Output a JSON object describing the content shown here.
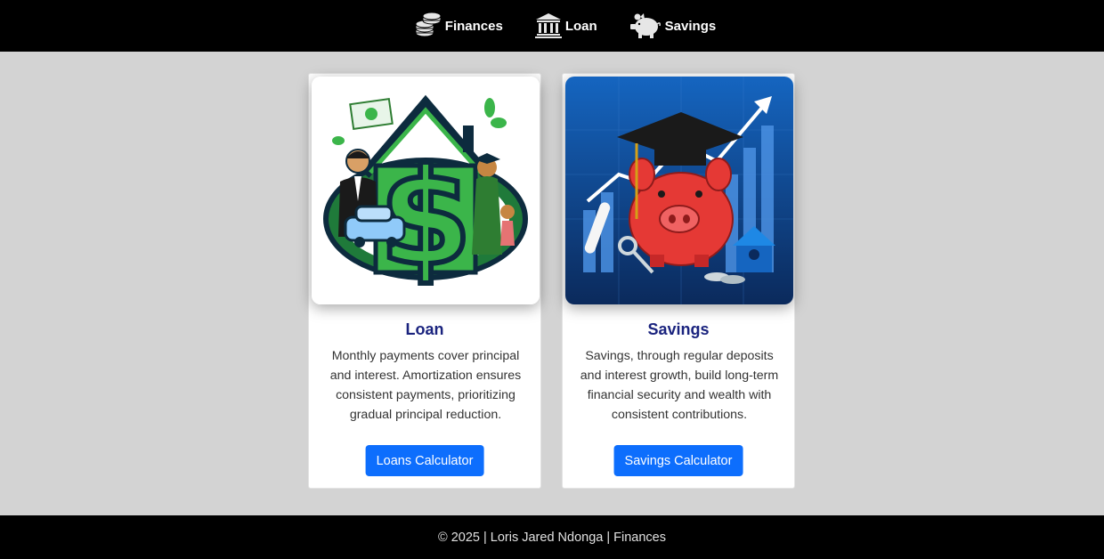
{
  "nav": {
    "items": [
      {
        "label": "Finances",
        "icon": "coins-stack-icon"
      },
      {
        "label": "Loan",
        "icon": "bank-icon"
      },
      {
        "label": "Savings",
        "icon": "piggy-bank-icon"
      }
    ]
  },
  "cards": [
    {
      "title": "Loan",
      "text": "Monthly payments cover principal and interest. Amortization ensures consistent payments, prioritizing gradual principal reduction.",
      "button": "Loans Calculator",
      "image": "loan-illustration"
    },
    {
      "title": "Savings",
      "text": "Savings, through regular deposits and interest growth, build long-term financial security and wealth with consistent contributions.",
      "button": "Savings Calculator",
      "image": "savings-illustration"
    }
  ],
  "footer": {
    "text": "© 2025 | Loris Jared Ndonga | Finances"
  },
  "colors": {
    "navbar": "#000000",
    "background": "#d3d3d3",
    "button": "#0d6efd",
    "title": "#1a237e"
  }
}
